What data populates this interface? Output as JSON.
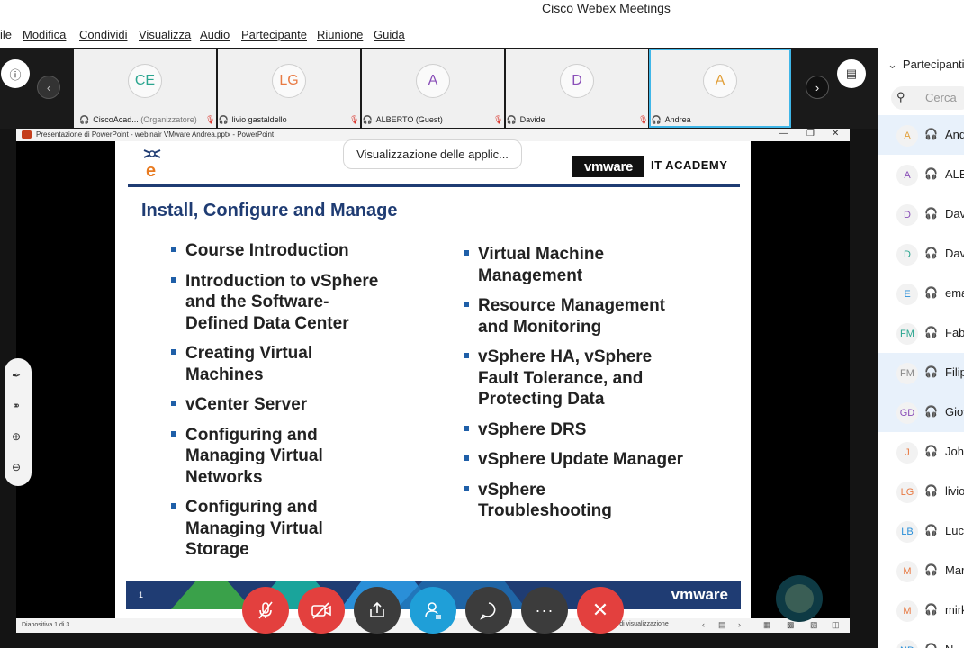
{
  "window": {
    "title": "Cisco Webex Meetings"
  },
  "menu": [
    "ile",
    "Modifica",
    "Condividi",
    "Visualizza",
    "Audio",
    "Partecipante",
    "Riunione",
    "Guida"
  ],
  "tiles": [
    {
      "initials": "CE",
      "name": "CiscoAcad...",
      "role": "(Organizzatore)",
      "color": "#2aa58f",
      "muted": false
    },
    {
      "initials": "LG",
      "name": "livio gastaldello",
      "role": "",
      "color": "#e87a43",
      "muted": true
    },
    {
      "initials": "A",
      "name": "ALBERTO (Guest)",
      "role": "",
      "color": "#8a4fb8",
      "muted": true
    },
    {
      "initials": "D",
      "name": "Davide",
      "role": "",
      "color": "#8a4fb8",
      "muted": true
    },
    {
      "initials": "A",
      "name": "Andrea",
      "role": "",
      "color": "#e2a03a",
      "muted": true
    }
  ],
  "ppt": {
    "title": "Presentazione di PowerPoint - webinair VMware Andrea.pptx - PowerPoint",
    "status_left": "Diapositiva 1 di 3",
    "status_right": "azioni di visualizzazione"
  },
  "share_tooltip": "Visualizzazione delle applic...",
  "slide": {
    "vm_logo": "vmware",
    "it_academy": "IT ACADEMY",
    "title": "Install, Configure and Manage",
    "left_bullets": [
      "Course Introduction",
      "Introduction to vSphere and the Software-Defined Data Center",
      "Creating Virtual Machines",
      "vCenter Server",
      "Configuring and Managing Virtual Networks",
      "Configuring and Managing Virtual Storage"
    ],
    "right_bullets": [
      "Virtual Machine Management",
      "Resource Management and Monitoring",
      "vSphere HA, vSphere Fault Tolerance, and Protecting Data",
      "vSphere DRS",
      "vSphere Update Manager",
      "vSphere Troubleshooting"
    ],
    "page_number": "1",
    "footer_logo": "vmware"
  },
  "panel": {
    "header": "Partecipanti",
    "search_placeholder": "Cerca",
    "participants": [
      {
        "initials": "A",
        "name": "Andrea",
        "color": "#e2a03a",
        "highlight": true
      },
      {
        "initials": "A",
        "name": "ALBERTO",
        "color": "#8a4fb8",
        "highlight": false
      },
      {
        "initials": "D",
        "name": "Davide",
        "color": "#8a4fb8",
        "highlight": false
      },
      {
        "initials": "D",
        "name": "Davide",
        "color": "#2aa58f",
        "highlight": false
      },
      {
        "initials": "E",
        "name": "emanuele",
        "color": "#2a8fd8",
        "highlight": false
      },
      {
        "initials": "FM",
        "name": "Fabio",
        "color": "#2aa58f",
        "highlight": false
      },
      {
        "initials": "FM",
        "name": "Filippo",
        "color": "#8a8a8a",
        "highlight": true
      },
      {
        "initials": "GD",
        "name": "Giovanni",
        "color": "#8a4fb8",
        "highlight": true
      },
      {
        "initials": "J",
        "name": "John",
        "color": "#e87a43",
        "highlight": false
      },
      {
        "initials": "LG",
        "name": "livio",
        "color": "#e87a43",
        "highlight": false
      },
      {
        "initials": "LB",
        "name": "Luca",
        "color": "#2a8fd8",
        "highlight": false
      },
      {
        "initials": "M",
        "name": "Marco",
        "color": "#e87a43",
        "highlight": false
      },
      {
        "initials": "M",
        "name": "mirko",
        "color": "#e87a43",
        "highlight": false
      },
      {
        "initials": "ND",
        "name": "N",
        "color": "#2a8fd8",
        "highlight": false
      }
    ]
  },
  "colors": {
    "accent": "#1f9fd8",
    "danger": "#e3403e",
    "slide_blue": "#1f3c73"
  }
}
